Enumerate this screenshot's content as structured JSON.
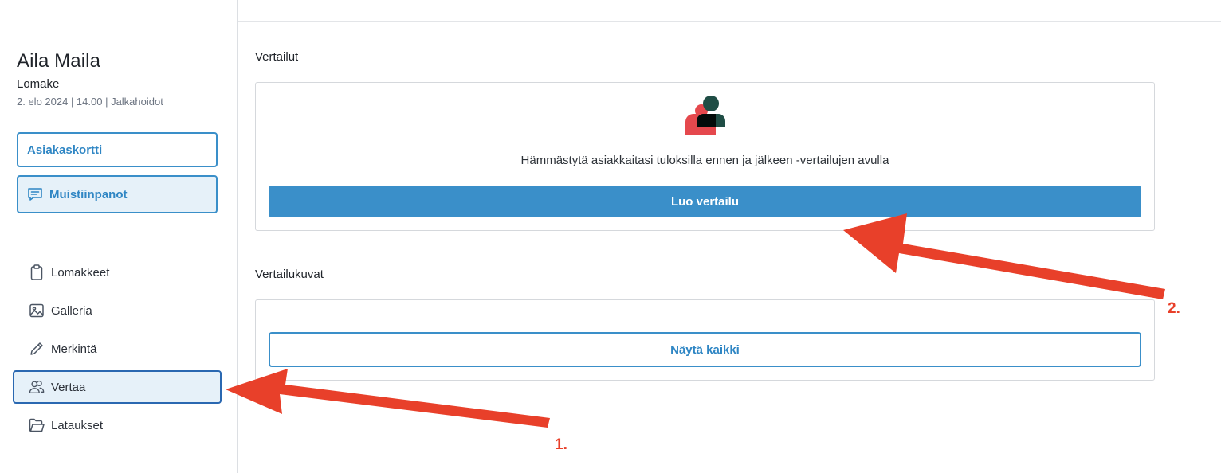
{
  "client": {
    "name": "Aila Maila",
    "form": "Lomake",
    "meta": "2. elo 2024 | 14.00 | Jalkahoidot"
  },
  "sidebar_buttons": {
    "customer_card": "Asiakaskortti",
    "notes": "Muistiinpanot"
  },
  "nav": {
    "items": [
      {
        "label": "Lomakkeet",
        "icon": "clipboard-icon"
      },
      {
        "label": "Galleria",
        "icon": "image-icon"
      },
      {
        "label": "Merkintä",
        "icon": "pencil-icon"
      },
      {
        "label": "Vertaa",
        "icon": "users-icon",
        "active": true
      },
      {
        "label": "Lataukset",
        "icon": "folder-icon"
      }
    ]
  },
  "comparisons": {
    "title": "Vertailut",
    "promo": "Hämmästytä asiakkaitasi tuloksilla ennen ja jälkeen -vertailujen avulla",
    "create_button": "Luo vertailu"
  },
  "comparison_images": {
    "title": "Vertailukuvat",
    "show_all_button": "Näytä kaikki"
  },
  "annotations": {
    "step1": "1.",
    "step2": "2."
  },
  "colors": {
    "accent": "#3a8fc9",
    "active_border": "#2a68b1",
    "arrow": "#e8402a",
    "icon_red": "#e5484d",
    "icon_dark": "#1f4d45"
  }
}
